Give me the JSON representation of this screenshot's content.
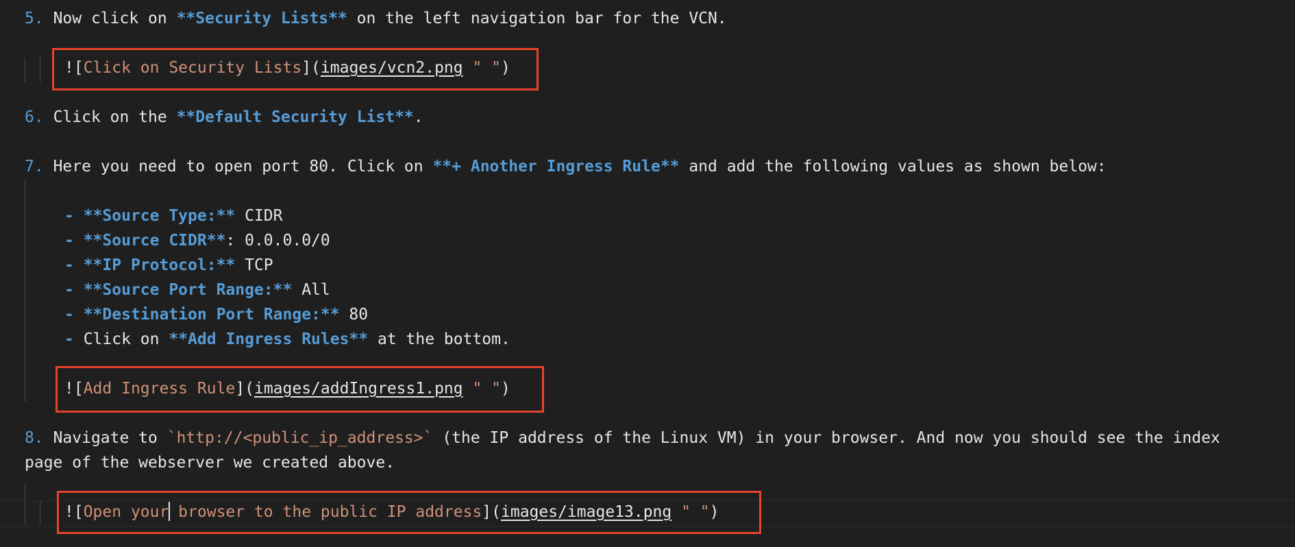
{
  "step5": {
    "num": "5.",
    "text_a": "Now click on ",
    "bold": "**Security Lists**",
    "text_b": " on the left navigation bar for the VCN."
  },
  "img1": {
    "prefix": "![",
    "alt": "Click on Security Lists",
    "mid": "](",
    "url": "images/vcn2.png",
    "title": "\" \"",
    "suffix": ")"
  },
  "step6": {
    "num": "6.",
    "text_a": "Click on the ",
    "bold": "**Default Security List**",
    "text_b": "."
  },
  "step7": {
    "num": "7.",
    "text_a": "Here you need to open port 80. Click on ",
    "bold": "**+ Another Ingress Rule**",
    "text_b": " and add the following values as shown below:"
  },
  "bullets": [
    {
      "dash": "- ",
      "bold": "**Source Type:**",
      "text": " CIDR"
    },
    {
      "dash": "- ",
      "bold": "**Source CIDR**",
      "text": ": 0.0.0.0/0"
    },
    {
      "dash": "- ",
      "bold": "**IP Protocol:**",
      "text": " TCP"
    },
    {
      "dash": "- ",
      "bold": "**Source Port Range:**",
      "text": " All"
    },
    {
      "dash": "- ",
      "bold": "**Destination Port Range:**",
      "text": " 80"
    },
    {
      "dash": "- ",
      "pre": "Click on ",
      "bold": "**Add Ingress Rules**",
      "text": " at the bottom."
    }
  ],
  "img2": {
    "prefix": "![",
    "alt": "Add Ingress Rule",
    "mid": "](",
    "url": "images/addIngress1.png",
    "title": "\" \"",
    "suffix": ")"
  },
  "step8": {
    "num": "8.",
    "text_a": "Navigate to ",
    "code": "`http://<public_ip_address>`",
    "text_b": " (the IP address of the Linux VM) in your browser. And now you should see the index",
    "text_c": "page of the webserver we created above."
  },
  "img3": {
    "prefix": "![",
    "alt_a": "Open your",
    "alt_b": " browser to the public IP address",
    "mid": "](",
    "url": "images/image13.png",
    "title": "\" \"",
    "suffix": ")"
  },
  "colors": {
    "background": "#1f1f1f",
    "keyword": "#569cd6",
    "string": "#ce9178",
    "text": "#e6e6e6",
    "highlight_box": "#e8432a"
  }
}
